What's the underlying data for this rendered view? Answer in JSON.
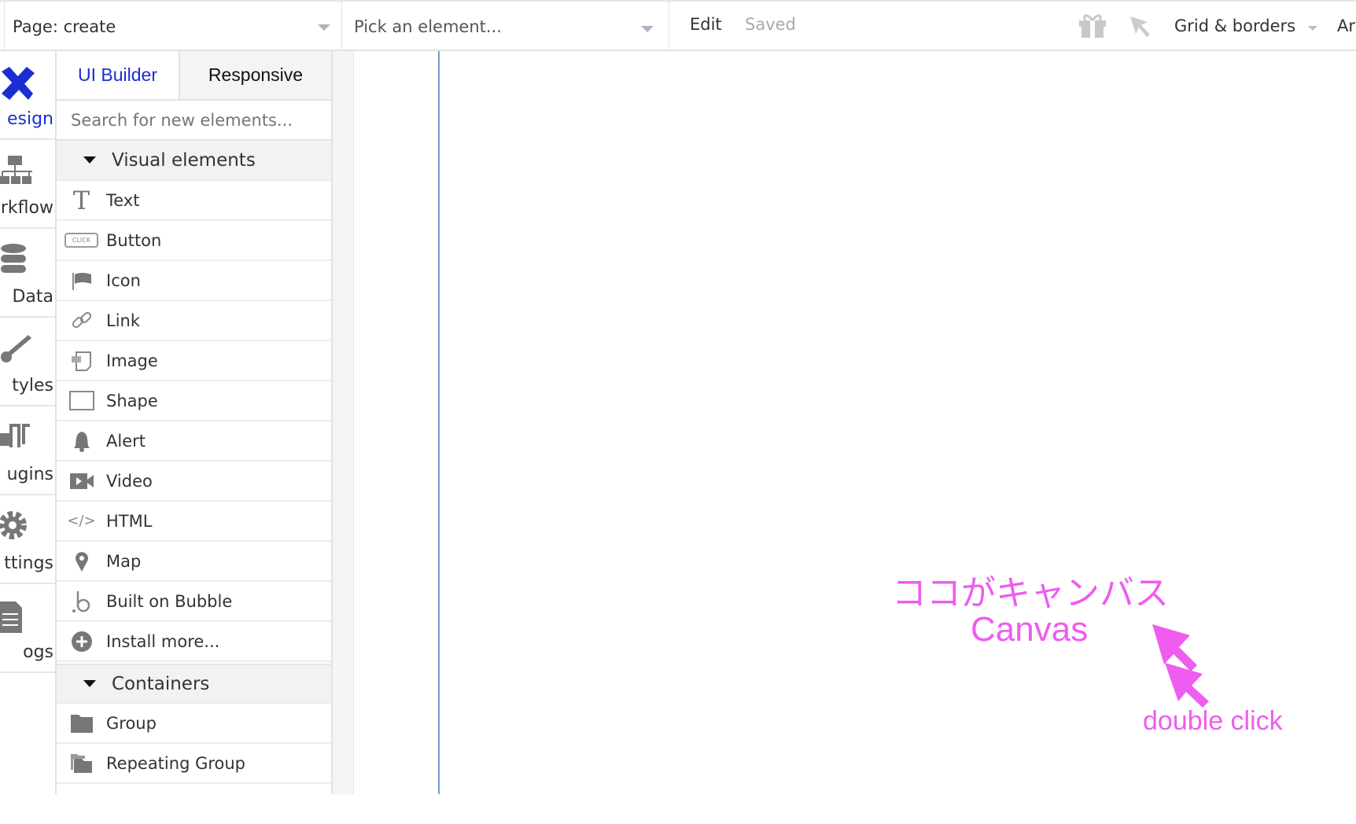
{
  "topbar": {
    "page_dropdown": "Page: create",
    "element_picker_placeholder": "Pick an element...",
    "edit": "Edit",
    "status": "Saved",
    "grid_borders": "Grid & borders",
    "truncated_menu": "Ar"
  },
  "nav": [
    {
      "label": "esign",
      "icon": "design-icon",
      "active": true
    },
    {
      "label": "rkflow",
      "icon": "workflow-icon"
    },
    {
      "label": "Data",
      "icon": "database-icon"
    },
    {
      "label": "tyles",
      "icon": "brush-icon"
    },
    {
      "label": "ugins",
      "icon": "plugin-icon"
    },
    {
      "label": "ttings",
      "icon": "gear-icon"
    },
    {
      "label": "ogs",
      "icon": "document-icon"
    }
  ],
  "panel": {
    "tabs": [
      "UI Builder",
      "Responsive"
    ],
    "search_placeholder": "Search for new elements...",
    "sections": [
      {
        "title": "Visual elements",
        "items": [
          "Text",
          "Button",
          "Icon",
          "Link",
          "Image",
          "Shape",
          "Alert",
          "Video",
          "HTML",
          "Map",
          "Built on Bubble",
          "Install more..."
        ]
      },
      {
        "title": "Containers",
        "items": [
          "Group",
          "Repeating Group"
        ]
      }
    ],
    "button_icon_text": "CLICK"
  },
  "annotation": {
    "jp": "ココがキャンバス",
    "en": "Canvas",
    "hint": "double click",
    "color": "#ee5cf0"
  },
  "colors": {
    "accent": "#1a2fd1",
    "guide": "#6e9fd4"
  }
}
